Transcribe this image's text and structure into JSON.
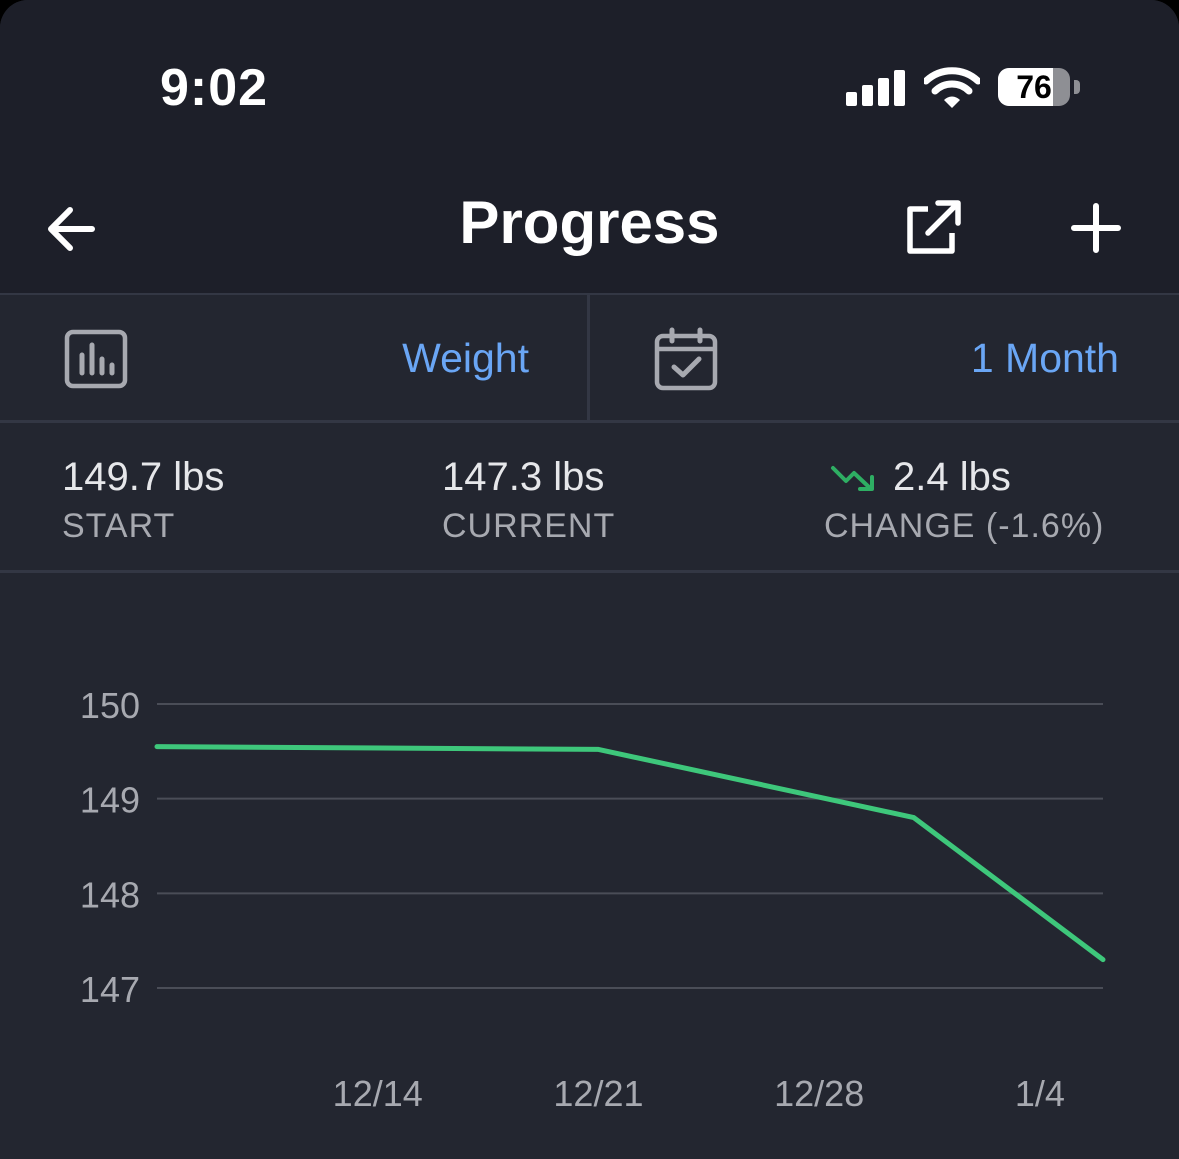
{
  "status_bar": {
    "time": "9:02",
    "battery_level": "76",
    "battery_fraction": 0.76
  },
  "nav": {
    "title": "Progress",
    "back_icon": "arrow-left-icon",
    "share_icon": "external-link-icon",
    "add_icon": "plus-icon"
  },
  "selector": {
    "metric_icon": "bar-chart-icon",
    "metric_label": "Weight",
    "range_icon": "calendar-check-icon",
    "range_label": "1 Month"
  },
  "stats": {
    "start_value": "149.7 lbs",
    "start_label": "START",
    "current_value": "147.3 lbs",
    "current_label": "CURRENT",
    "change_value": "2.4 lbs",
    "change_label": "CHANGE (-1.6%)",
    "change_icon": "trend-down-icon"
  },
  "colors": {
    "accent": "#6aa6f5",
    "line": "#3ec77b",
    "background": "#232630",
    "header": "#1d1f29"
  },
  "chart_data": {
    "type": "line",
    "x_ticks": [
      "12/14",
      "12/21",
      "12/28",
      "1/4"
    ],
    "y_ticks": [
      150,
      149,
      148,
      147
    ],
    "ylim": [
      147,
      150
    ],
    "series": [
      {
        "values": [
          {
            "x": "12/7",
            "y": 149.55
          },
          {
            "x": "12/21",
            "y": 149.52
          },
          {
            "x": "12/31",
            "y": 148.8
          },
          {
            "x": "1/6",
            "y": 147.3
          }
        ]
      }
    ],
    "grid": true
  }
}
